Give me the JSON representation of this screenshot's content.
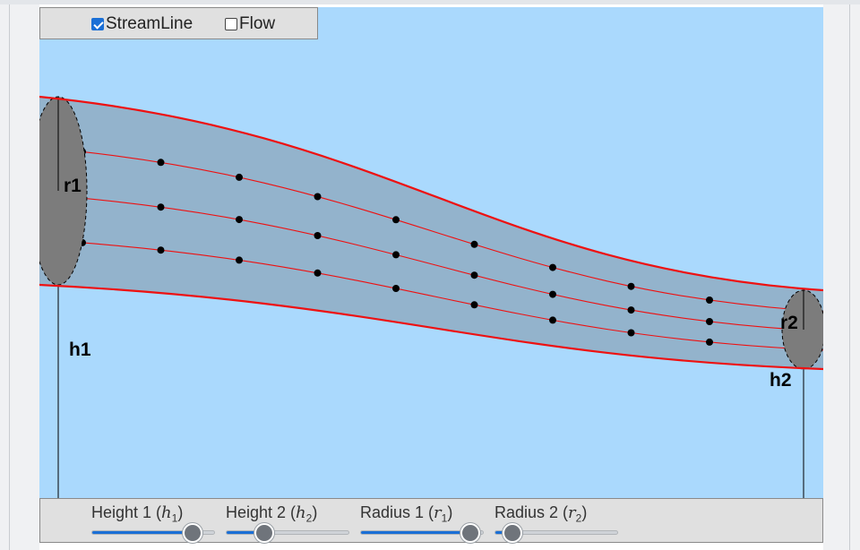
{
  "checkboxes": {
    "streamline": {
      "label": "StreamLine",
      "checked": true
    },
    "flow": {
      "label": "Flow",
      "checked": false
    }
  },
  "figure": {
    "label_r1": "r1",
    "label_r2": "r2",
    "label_h1": "h1",
    "label_h2": "h2"
  },
  "sliders": [
    {
      "name": "height-1",
      "prefix": "Height 1 (",
      "var": "h",
      "sub": "1",
      "suffix": ")",
      "value": 0.82
    },
    {
      "name": "height-2",
      "prefix": "Height 2 (",
      "var": "h",
      "sub": "2",
      "suffix": ")",
      "value": 0.31
    },
    {
      "name": "radius-1",
      "prefix": "Radius 1 (",
      "var": "r",
      "sub": "1",
      "suffix": ")",
      "value": 0.9
    },
    {
      "name": "radius-2",
      "prefix": "Radius 2 (",
      "var": "r",
      "sub": "2",
      "suffix": ")",
      "value": 0.14
    }
  ],
  "colors": {
    "background": "#aad9fd",
    "tube_fill": "#93b3cc",
    "boundary": "#ee1111",
    "disk": "#7c7c7c",
    "slider_accent": "#1a6fd6"
  }
}
